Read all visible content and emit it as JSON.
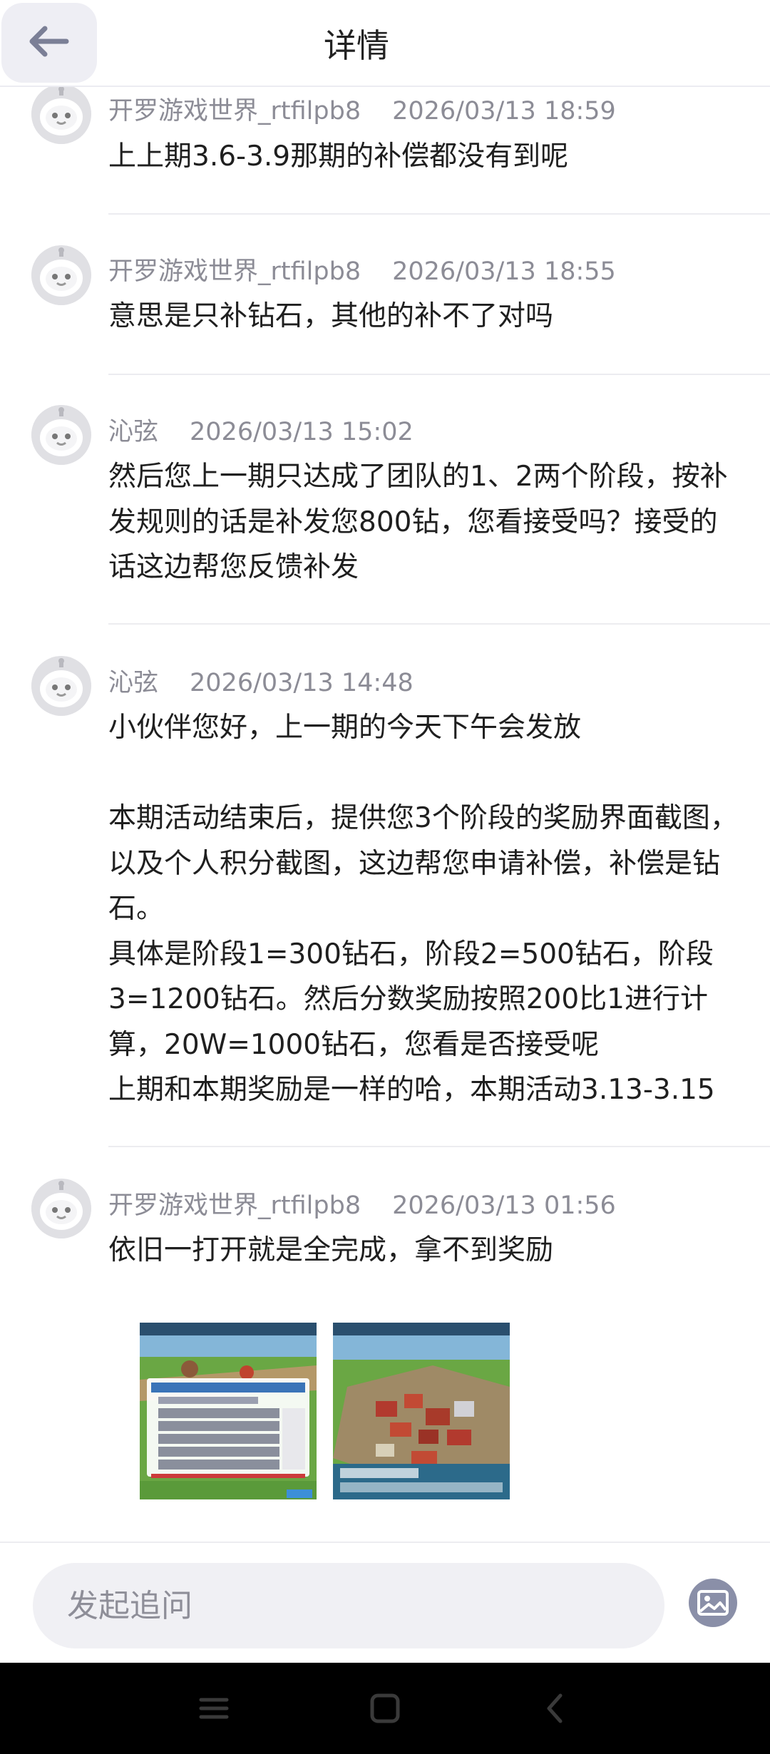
{
  "header": {
    "title": "详情",
    "back_icon": "arrow-left-icon"
  },
  "messages": [
    {
      "author": "开罗游戏世界_rtfilpb8",
      "time": "2026/03/13 18:59",
      "text": "上上期3.6-3.9那期的补偿都没有到呢"
    },
    {
      "author": "开罗游戏世界_rtfilpb8",
      "time": "2026/03/13 18:55",
      "text": "意思是只补钻石，其他的补不了对吗"
    },
    {
      "author": "沁弦",
      "time": "2026/03/13 15:02",
      "text": "然后您上一期只达成了团队的1、2两个阶段，按补发规则的话是补发您800钻，您看接受吗？接受的话这边帮您反馈补发"
    },
    {
      "author": "沁弦",
      "time": "2026/03/13 14:48",
      "text": "小伙伴您好，上一期的今天下午会发放\n\n本期活动结束后，提供您3个阶段的奖励界面截图，以及个人积分截图，这边帮您申请补偿，补偿是钻石。\n具体是阶段1=300钻石，阶段2=500钻石，阶段3=1200钻石。然后分数奖励按照200比1进行计算，20W=1000钻石，您看是否接受呢\n上期和本期奖励是一样的哈，本期活动3.13-3.15"
    },
    {
      "author": "开罗游戏世界_rtfilpb8",
      "time": "2026/03/13 01:56",
      "text": "依旧一打开就是全完成，拿不到奖励"
    }
  ],
  "composer": {
    "placeholder": "发起追问",
    "image_icon": "image-upload-icon"
  },
  "colors": {
    "meta": "#8c8c96",
    "text": "#1f1f1f",
    "accent": "#8a8fa8"
  }
}
